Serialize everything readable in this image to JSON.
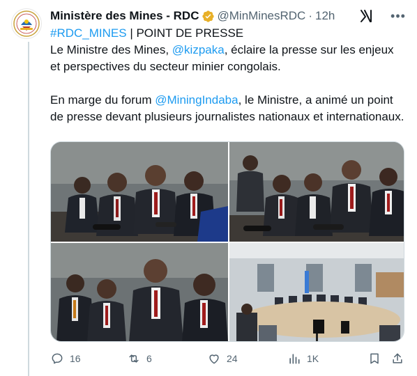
{
  "author": {
    "name": "Ministère des Mines - RDC",
    "handle": "@MinMinesRDC",
    "separator": "·",
    "time": "12h",
    "verified": true,
    "avatar_icon": "government-seal-icon"
  },
  "tweet": {
    "hashtag": "#RDC_MINES",
    "line1_rest": " | POINT DE PRESSE",
    "line2_before": "Le Ministre des Mines, ",
    "mention1": "@kizpaka",
    "line2_after": ", éclaire la presse sur les enjeux et perspectives du secteur minier congolais.",
    "line3_before": "En marge du forum ",
    "mention2": "@MiningIndaba",
    "line3_after": ", le Ministre, a animé un point de presse devant plusieurs journalistes nationaux et internationaux."
  },
  "media": {
    "count": 4,
    "photos": [
      "press-conference-photo-1",
      "press-conference-photo-2",
      "press-conference-photo-3",
      "press-conference-photo-4"
    ]
  },
  "actions": {
    "replies": "16",
    "retweets": "6",
    "likes": "24",
    "views": "1K"
  },
  "colors": {
    "link": "#1d9bf0",
    "text": "#0f1419",
    "muted": "#536471",
    "verified_gold": "#e8b028"
  }
}
